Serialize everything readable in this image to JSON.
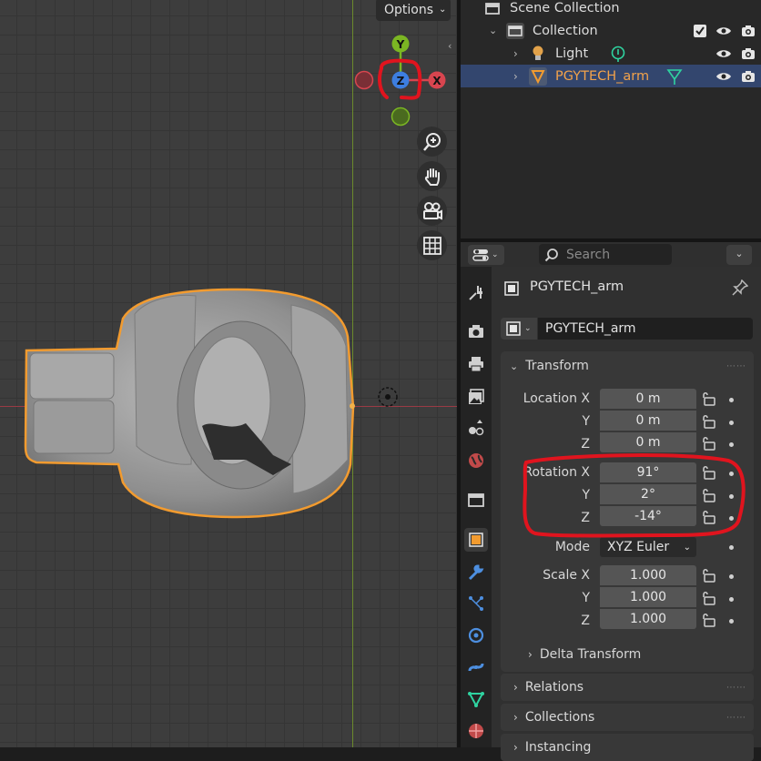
{
  "viewport": {
    "options_label": "Options",
    "gizmo": {
      "y_label": "Y",
      "z_label": "Z",
      "x_label": "X"
    },
    "colors": {
      "x_axis": "#d8454f",
      "y_axis": "#7bb623",
      "z_axis": "#3d7ee0",
      "selection_outline": "#f29b2f",
      "annotation": "#e0141e"
    }
  },
  "outliner": {
    "scene_collection": "Scene Collection",
    "collection": "Collection",
    "items": [
      {
        "label": "Light"
      },
      {
        "label": "PGYTECH_arm"
      }
    ]
  },
  "properties": {
    "search_placeholder": "Search",
    "object_name": "PGYTECH_arm",
    "object_field": "PGYTECH_arm",
    "transform": {
      "title": "Transform",
      "location": {
        "label_x": "Location X",
        "label_y": "Y",
        "label_z": "Z",
        "x": "0 m",
        "y": "0 m",
        "z": "0 m"
      },
      "rotation": {
        "label_x": "Rotation X",
        "label_y": "Y",
        "label_z": "Z",
        "x": "91°",
        "y": "2°",
        "z": "-14°"
      },
      "mode": {
        "label": "Mode",
        "value": "XYZ Euler"
      },
      "scale": {
        "label_x": "Scale X",
        "label_y": "Y",
        "label_z": "Z",
        "x": "1.000",
        "y": "1.000",
        "z": "1.000"
      },
      "delta": "Delta Transform"
    },
    "relations": "Relations",
    "collections": "Collections",
    "instancing": "Instancing"
  }
}
